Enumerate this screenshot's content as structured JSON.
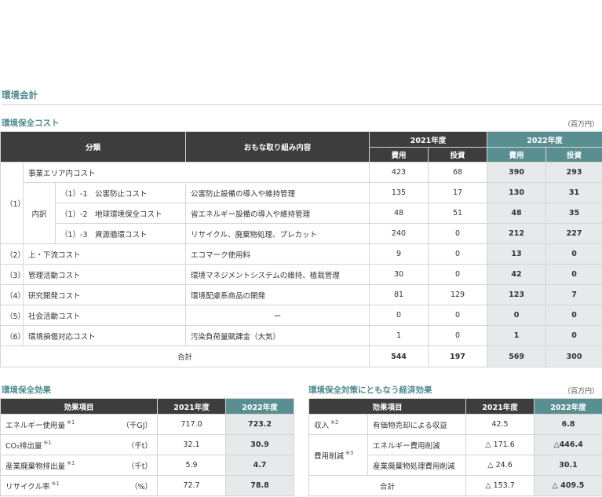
{
  "section_title": "環境会計",
  "cost": {
    "title": "環境保全コスト",
    "unit": "（百万円）",
    "headers": {
      "category": "分類",
      "activity": "おもな取り組み内容",
      "y2021": "2021年度",
      "y2022": "2022年度",
      "cost": "費用",
      "invest": "投資"
    },
    "rows": [
      {
        "no": "（1）",
        "naiyaku": "内訳",
        "item": "事業エリア内コスト",
        "act": "",
        "c21": "423",
        "i21": "68",
        "c22": "390",
        "i22": "293"
      },
      {
        "item": "（1）-1　公害防止コスト",
        "act": "公害防止設備の導入や維持管理",
        "c21": "135",
        "i21": "17",
        "c22": "130",
        "i22": "31"
      },
      {
        "item": "（1）-2　地球環境保全コスト",
        "act": "省エネルギー設備の導入や維持管理",
        "c21": "48",
        "i21": "51",
        "c22": "48",
        "i22": "35"
      },
      {
        "item": "（1）-3　資源循環コスト",
        "act": "リサイクル、廃棄物処理、プレカット",
        "c21": "240",
        "i21": "0",
        "c22": "212",
        "i22": "227"
      },
      {
        "no": "（2）",
        "item": "上・下流コスト",
        "act": "エコマーク使用料",
        "c21": "9",
        "i21": "0",
        "c22": "13",
        "i22": "0"
      },
      {
        "no": "（3）",
        "item": "管理活動コスト",
        "act": "環境マネジメントシステムの維持、植栽管理",
        "c21": "30",
        "i21": "0",
        "c22": "42",
        "i22": "0"
      },
      {
        "no": "（4）",
        "item": "研究開発コスト",
        "act": "環境配慮系商品の開発",
        "c21": "81",
        "i21": "129",
        "c22": "123",
        "i22": "7"
      },
      {
        "no": "（5）",
        "item": "社会活動コスト",
        "act": "ー",
        "c21": "0",
        "i21": "0",
        "c22": "0",
        "i22": "0"
      },
      {
        "no": "（6）",
        "item": "環境損傷対応コスト",
        "act": "汚染負荷量賦課金（大気）",
        "c21": "1",
        "i21": "0",
        "c22": "1",
        "i22": "0"
      }
    ],
    "total": {
      "label": "合計",
      "c21": "544",
      "i21": "197",
      "c22": "569",
      "i22": "300"
    }
  },
  "effect": {
    "title": "環境保全効果",
    "headers": {
      "item": "効果項目",
      "y2021": "2021年度",
      "y2022": "2022年度"
    },
    "rows": [
      {
        "label": "エネルギー使用量",
        "note": "※1",
        "unit": "（千GJ）",
        "v21": "717.0",
        "v22": "723.2"
      },
      {
        "label": "CO₂排出量",
        "note": "※1",
        "unit": "（千t）",
        "v21": "32.1",
        "v22": "30.9"
      },
      {
        "label": "産業廃棄物排出量",
        "note": "※1",
        "unit": "（千t）",
        "v21": "5.9",
        "v22": "4.7"
      },
      {
        "label": "リサイクル率",
        "note": "※1",
        "unit": "（%）",
        "v21": "72.7",
        "v22": "78.8"
      }
    ]
  },
  "econ": {
    "title": "環境保全対策にともなう経済効果",
    "unit": "（百万円）",
    "headers": {
      "item": "効果項目",
      "y2021": "2021年度",
      "y2022": "2022年度"
    },
    "income": {
      "label": "収入",
      "note": "※2",
      "detail": "有価物売却による収益",
      "v21": "42.5",
      "v22": "6.8"
    },
    "reduction": {
      "label": "費用削減",
      "note": "※3",
      "rows": [
        {
          "detail": "エネルギー費用削減",
          "v21": "△ 171.6",
          "v22": "△446.4"
        },
        {
          "detail": "産業廃棄物処理費用削減",
          "v21": "△ 24.6",
          "v22": "30.1"
        }
      ]
    },
    "total": {
      "label": "合計",
      "v21": "△ 153.7",
      "v22": "△ 409.5"
    }
  }
}
